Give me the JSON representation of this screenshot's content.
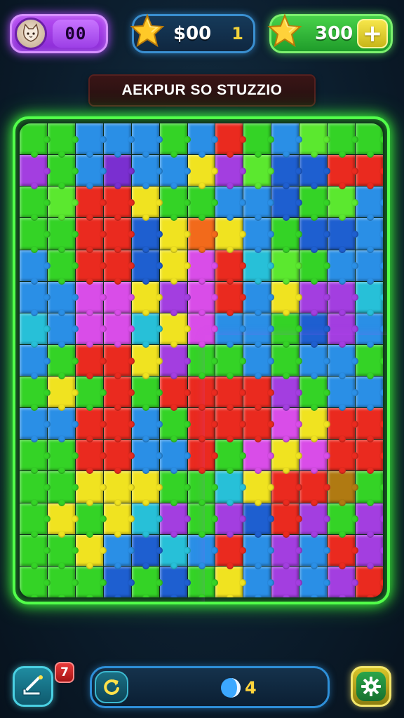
{
  "header": {
    "player_value": "00",
    "coins_value": "$00",
    "coins_extra": "1",
    "stars_value": "300",
    "plus_label": "+"
  },
  "title": "AEKPUR SO STUZZIO",
  "footer": {
    "hint_badge": "7",
    "gem_count": "4"
  },
  "board": {
    "cols": 13,
    "rows": 15,
    "palette": {
      "G": "#34d326",
      "g": "#5be82f",
      "Y": "#f0e320",
      "R": "#ea2a1f",
      "O": "#f26a1b",
      "B": "#2a8fe6",
      "b": "#1e5fd0",
      "C": "#27c0d8",
      "P": "#a33ee0",
      "p": "#7a2fd0",
      "M": "#d94de8",
      "N": "#b07a12"
    },
    "layout": [
      "GGBBBGBRGBgGG",
      "PGBpBBYPgbbRR",
      "GgRRYGGBBbGgB",
      "GGRRbYOYBGbbB",
      "BGRRbYMRCgGBB",
      "BBMMYPMRBYPPC",
      "CBMMCYMBBGbPB",
      "BGRRYPGGBGBBG",
      "GYGRGRRRRPGBB",
      "BBRRBGRRRMYRR",
      "GGRRBBRGMYMRR",
      "GGYYYGGCYRRNG",
      "GYGYCPGPbRPGP",
      "GGYBbCBRBPBRP",
      "GGGbGbGYBPBPR"
    ]
  }
}
